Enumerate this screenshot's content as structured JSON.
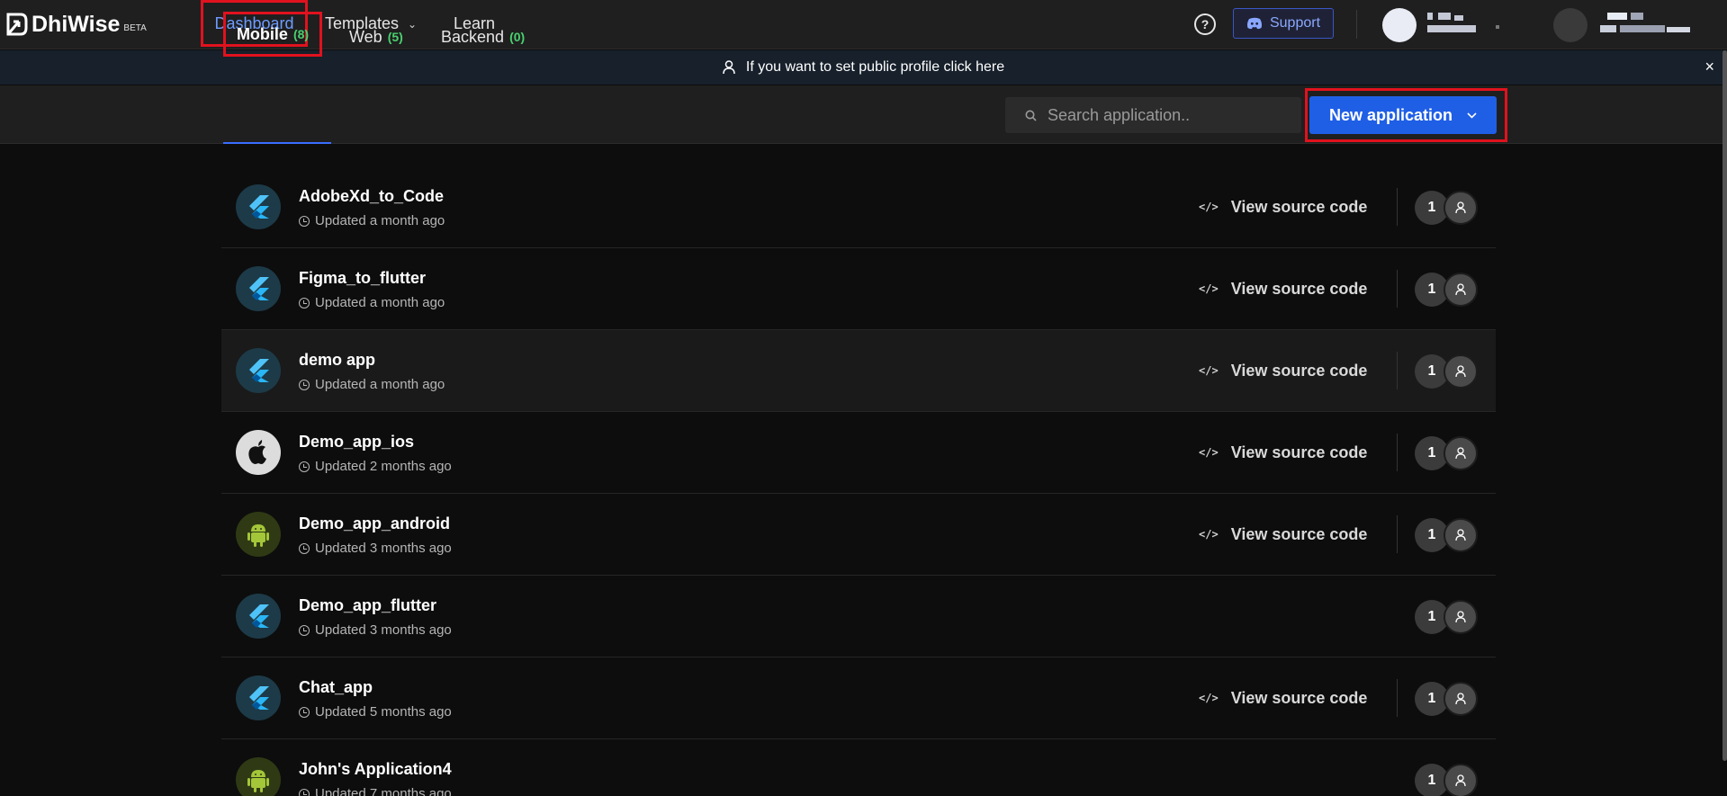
{
  "brand": {
    "name": "DhiWise",
    "badge": "BETA"
  },
  "nav": {
    "dashboard": "Dashboard",
    "templates": "Templates",
    "learn": "Learn"
  },
  "header": {
    "help_label": "?",
    "support": "Support"
  },
  "banner": {
    "text": "If you want to set public profile click here",
    "close": "×"
  },
  "tabs": [
    {
      "label": "Mobile",
      "count": "(8)"
    },
    {
      "label": "Web",
      "count": "(5)"
    },
    {
      "label": "Backend",
      "count": "(0)"
    }
  ],
  "search": {
    "placeholder": "Search application.."
  },
  "new_app": {
    "label": "New application"
  },
  "apps": [
    {
      "name": "AdobeXd_to_Code",
      "updated": "Updated a month ago",
      "platform": "flutter",
      "view_source": "View source code",
      "members": "1"
    },
    {
      "name": "Figma_to_flutter",
      "updated": "Updated a month ago",
      "platform": "flutter",
      "view_source": "View source code",
      "members": "1"
    },
    {
      "name": "demo app",
      "updated": "Updated a month ago",
      "platform": "flutter",
      "view_source": "View source code",
      "members": "1"
    },
    {
      "name": "Demo_app_ios",
      "updated": "Updated 2 months ago",
      "platform": "ios",
      "view_source": "View source code",
      "members": "1"
    },
    {
      "name": "Demo_app_android",
      "updated": "Updated 3 months ago",
      "platform": "android",
      "view_source": "View source code",
      "members": "1"
    },
    {
      "name": "Demo_app_flutter",
      "updated": "Updated 3 months ago",
      "platform": "flutter",
      "view_source": "",
      "members": "1"
    },
    {
      "name": "Chat_app",
      "updated": "Updated 5 months ago",
      "platform": "flutter",
      "view_source": "View source code",
      "members": "1"
    },
    {
      "name": "John's Application4",
      "updated": "Updated 7 months ago",
      "platform": "android",
      "view_source": "",
      "members": "1"
    }
  ],
  "colors": {
    "accent": "#1f5fe6",
    "highlight": "#e0121e",
    "count_green": "#4ad06f",
    "nav_active": "#6d9cff"
  }
}
